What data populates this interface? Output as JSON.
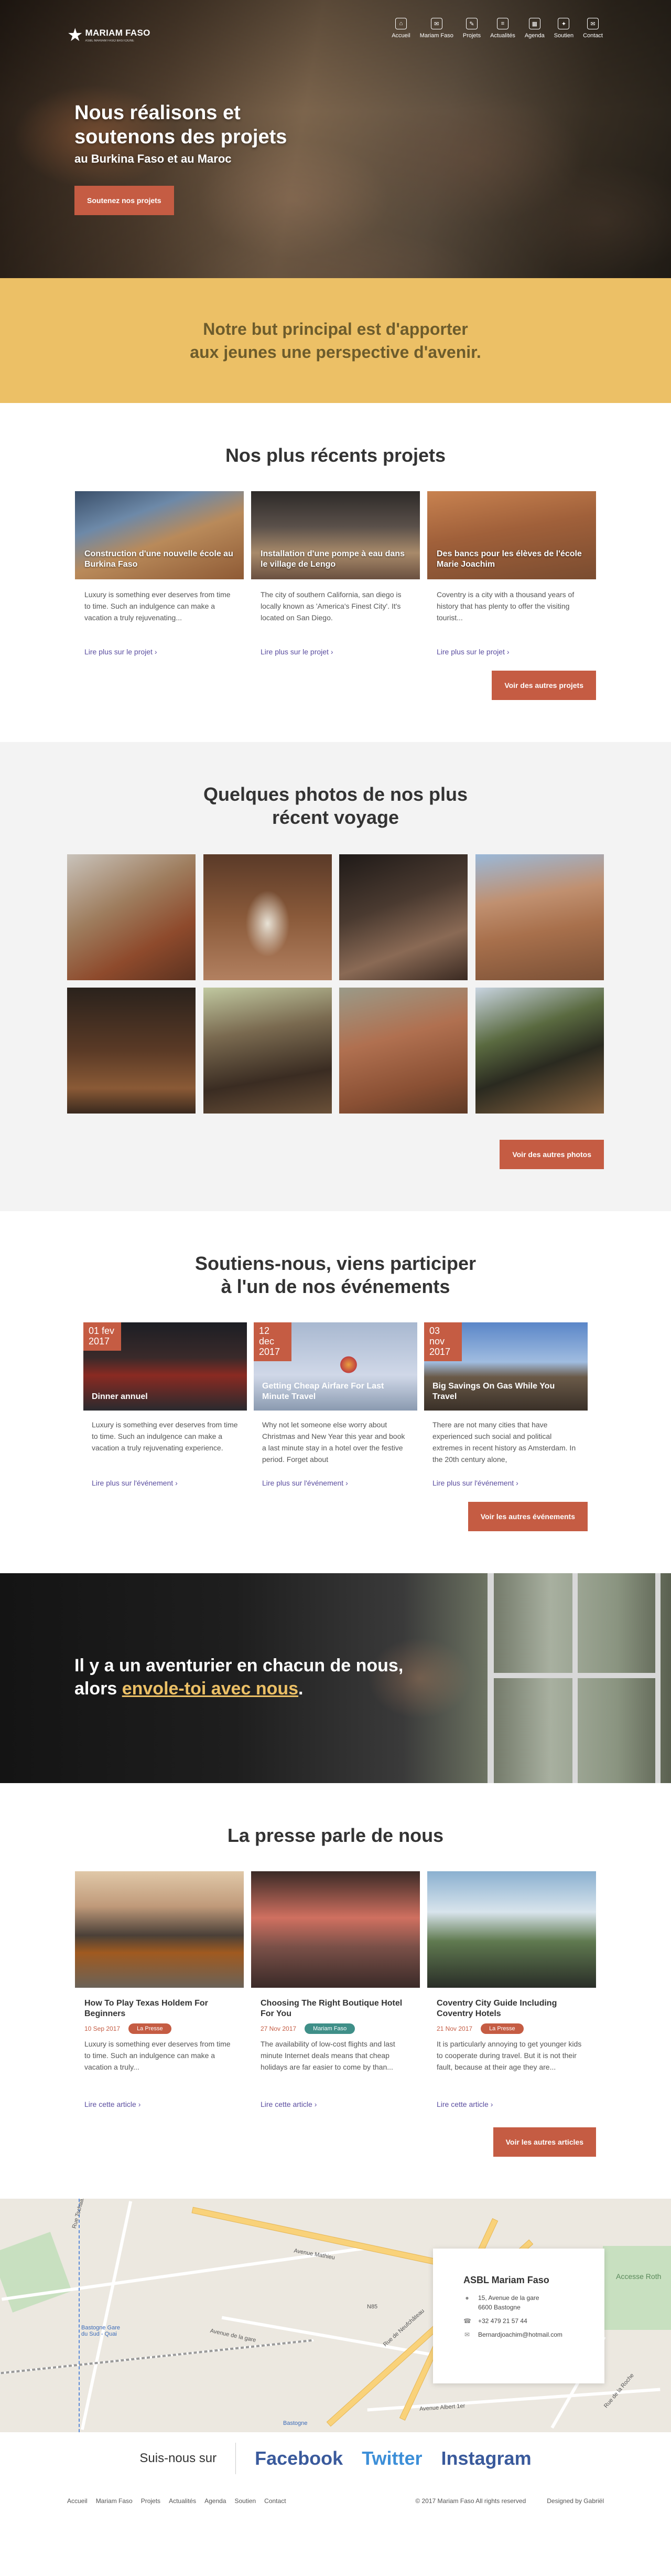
{
  "nav": {
    "logo": "MARIAM FASO",
    "logo_sub": "ASBL MARIAM FASO BASTOGNE",
    "items": [
      {
        "label": "Accueil",
        "icon": "home-icon",
        "glyph": "⌂"
      },
      {
        "label": "Mariam Faso",
        "icon": "chat-icon",
        "glyph": "✉"
      },
      {
        "label": "Projets",
        "icon": "pencil-icon",
        "glyph": "✎"
      },
      {
        "label": "Actualités",
        "icon": "document-icon",
        "glyph": "≡"
      },
      {
        "label": "Agenda",
        "icon": "calendar-icon",
        "glyph": "▦"
      },
      {
        "label": "Soutien",
        "icon": "gift-icon",
        "glyph": "✦"
      },
      {
        "label": "Contact",
        "icon": "envelope-icon",
        "glyph": "✉"
      }
    ]
  },
  "hero": {
    "title": "Nous réalisons et soutenons des projets",
    "subtitle": "au Burkina Faso et au Maroc",
    "button": "Soutenez nos projets"
  },
  "goal": {
    "line1": "Notre but principal est d'apporter",
    "line2": "aux jeunes une perspective d'avenir."
  },
  "projects": {
    "title": "Nos plus récents projets",
    "items": [
      {
        "title": "Construction d'une nouvelle école au Burkina Faso",
        "text": "Luxury is something ever  deserves from time to time. Such an indulgence can make a vacation a truly rejuvenating...",
        "link": "Lire plus sur le projet  ›"
      },
      {
        "title": "Installation d'une pompe à eau dans  le village de Lengo",
        "text": "The city of southern California, san diego is locally known as 'America's Finest City'. It's located on San Diego.",
        "link": "Lire plus sur le projet  ›"
      },
      {
        "title": "Des bancs pour les élèves de l'école Marie Joachim",
        "text": "Coventry is a city with a thousand years of history that has plenty to offer the visiting tourist...",
        "link": "Lire plus sur le projet  ›"
      }
    ],
    "button": "Voir des autres projets"
  },
  "photos": {
    "title_line1": "Quelques photos de nos plus",
    "title_line2": "récent voyage",
    "button": "Voir des autres photos"
  },
  "events": {
    "title_line1": "Soutiens-nous, viens participer",
    "title_line2": "à l'un de nos événements",
    "items": [
      {
        "date": "01 fev 2017",
        "title": "Dinner annuel",
        "text": "Luxury is something ever  deserves from time to time. Such an indulgence can make a vacation a truly rejuvenating experience.",
        "link": "Lire plus sur l'événement  ›"
      },
      {
        "date": "12 dec 2017",
        "title": "Getting Cheap Airfare For Last Minute Travel",
        "text": "Why not let someone else worry about Christmas and New Year this year and book a last minute stay in a hotel over the festive period. Forget about",
        "link": "Lire plus sur l'événement  ›"
      },
      {
        "date": "03 nov 2017",
        "title": "Big Savings On Gas While You Travel",
        "text": "There are not many cities that have experienced such social and political extremes in recent history as Amsterdam. In the 20th century alone,",
        "link": "Lire plus sur l'événement  ›"
      }
    ],
    "button": "Voir les autres événements"
  },
  "adventure": {
    "line1": "Il y a un aventurier en chacun de nous,",
    "line2_prefix": "alors ",
    "line2_highlight": "envole-toi avec nous",
    "line2_suffix": "."
  },
  "press": {
    "title": "La presse parle de nous",
    "items": [
      {
        "title": "How To Play Texas Holdem For Beginners",
        "date": "10 Sep 2017",
        "tag": "La Presse",
        "tag_color": "#c55c43",
        "text": "Luxury is something ever  deserves from time to time. Such an indulgence can make a vacation a truly...",
        "link": "Lire cette article  ›"
      },
      {
        "title": "Choosing The Right Boutique Hotel For You",
        "date": "27 Nov 2017",
        "tag": "Mariam Faso",
        "tag_color": "#3f8f88",
        "text": "The availability of low-cost flights and last minute Internet deals means that cheap holidays are far easier to come by than...",
        "link": "Lire cette article  ›"
      },
      {
        "title": "Coventry City Guide Including Coventry Hotels",
        "date": "21 Nov 2017",
        "tag": "La Presse",
        "tag_color": "#c55c43",
        "text": "It is particularly annoying to get younger kids to cooperate during travel. But it is not their fault, because at their age they are...",
        "link": "Lire cette article  ›"
      }
    ],
    "button": "Voir les autres articles"
  },
  "map": {
    "labels": [
      "Rue Tschaas",
      "Avenue Mathieu",
      "Avenue de la gare",
      "Rue de Neufchâteau",
      "Bastogne Gare du Sud - Quai",
      "Avenue Albert 1er",
      "N85",
      "Bastogne",
      "Rue de la Roche",
      "Accesse Roth"
    ]
  },
  "contact": {
    "name": "ASBL Mariam Faso",
    "address_line1": "15, Avenue de la gare",
    "address_line2": "6600 Bastogne",
    "phone": "+32 479 21 57 44",
    "email": "Bernardjoachim@hotmail.com"
  },
  "social": {
    "follow": "Suis-nous sur",
    "facebook": "Facebook",
    "twitter": "Twitter",
    "instagram": "Instagram"
  },
  "footer": {
    "menu": [
      "Accueil",
      "Mariam Faso",
      "Projets",
      "Actualités",
      "Agenda",
      "Soutien",
      "Contact"
    ],
    "copyright": "© 2017 Mariam Faso All rights reserved",
    "credit": "Designed by Gabriël"
  },
  "colors": {
    "accent": "#c55c43",
    "yellow": "#ecc066",
    "link": "#5b4ea0",
    "twitter": "#3d8fd8",
    "facebook": "#3a5a9c"
  }
}
